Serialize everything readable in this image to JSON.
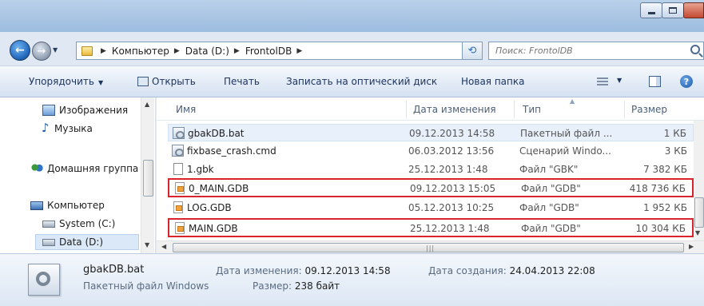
{
  "address": {
    "crumbs": [
      "Компьютер",
      "Data (D:)",
      "FrontolDB"
    ]
  },
  "search": {
    "placeholder": "Поиск: FrontolDB"
  },
  "toolbar": {
    "organize": "Упорядочить",
    "open": "Открыть",
    "print": "Печать",
    "burn": "Записать на оптический диск",
    "new_folder": "Новая папка"
  },
  "nav": {
    "items": [
      {
        "label": "Изображения",
        "icon": "pictures-icon"
      },
      {
        "label": "Музыка",
        "icon": "music-icon"
      },
      {
        "label": "Домашняя группа",
        "icon": "homegroup-icon"
      },
      {
        "label": "Компьютер",
        "icon": "computer-icon"
      },
      {
        "label": "System (C:)",
        "icon": "drive-icon"
      },
      {
        "label": "Data (D:)",
        "icon": "drive-icon"
      }
    ]
  },
  "columns": {
    "name": "Имя",
    "date": "Дата изменения",
    "type": "Тип",
    "size": "Размер"
  },
  "files": [
    {
      "name": "gbakDB.bat",
      "date": "09.12.2013 14:58",
      "type": "Пакетный файл ...",
      "size": "1 КБ",
      "icon": "batch-file-icon"
    },
    {
      "name": "fixbase_crash.cmd",
      "date": "06.03.2012 13:56",
      "type": "Сценарий Windo...",
      "size": "3 КБ",
      "icon": "cmd-file-icon"
    },
    {
      "name": "1.gbk",
      "date": "25.12.2013 1:48",
      "type": "Файл \"GBK\"",
      "size": "7 382 КБ",
      "icon": "file-icon"
    },
    {
      "name": "0_MAIN.GDB",
      "date": "09.12.2013 15:05",
      "type": "Файл \"GDB\"",
      "size": "418 736 КБ",
      "icon": "gdb-file-icon"
    },
    {
      "name": "LOG.GDB",
      "date": "05.12.2013 10:25",
      "type": "Файл \"GDB\"",
      "size": "1 952 КБ",
      "icon": "gdb-file-icon"
    },
    {
      "name": "MAIN.GDB",
      "date": "25.12.2013 1:48",
      "type": "Файл \"GDB\"",
      "size": "10 304 КБ",
      "icon": "gdb-file-icon"
    }
  ],
  "details": {
    "name": "gbakDB.bat",
    "type": "Пакетный файл Windows",
    "modified_label": "Дата изменения:",
    "modified_value": "09.12.2013 14:58",
    "created_label": "Дата создания:",
    "created_value": "24.04.2013 22:08",
    "size_label": "Размер:",
    "size_value": "238 байт"
  },
  "colors": {
    "highlight_box": "#d9232d",
    "selection": "#e8f1fb"
  }
}
